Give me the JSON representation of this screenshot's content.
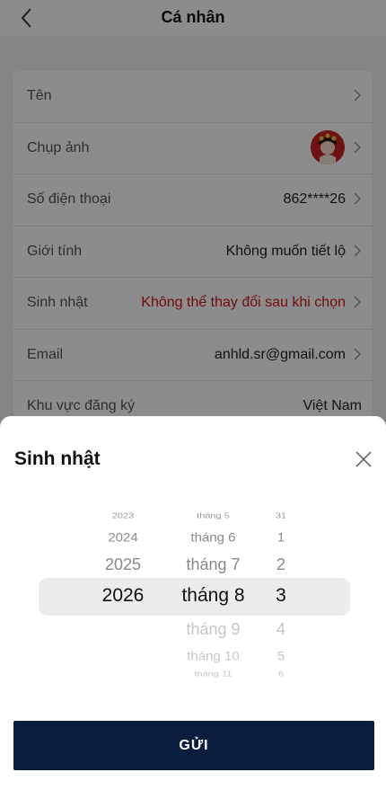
{
  "header": {
    "title": "Cá nhân"
  },
  "profile_rows": [
    {
      "label": "Tên",
      "value": ""
    },
    {
      "label": "Chụp ảnh",
      "value": ""
    },
    {
      "label": "Số điện thoại",
      "value": "862****26"
    },
    {
      "label": "Giới tính",
      "value": "Không muốn tiết lộ"
    },
    {
      "label": "Sinh nhật",
      "value": "Không thể thay đổi sau khi chọn"
    },
    {
      "label": "Email",
      "value": "anhld.sr@gmail.com"
    },
    {
      "label": "Khu vực đăng ký",
      "value": "Việt Nam"
    }
  ],
  "colors": {
    "warning": "#d4141c",
    "button": "#0b1d3f",
    "avatar": "#c82125"
  },
  "sheet": {
    "title": "Sinh nhật",
    "submit_label": "GỬI",
    "years": [
      "2023",
      "2024",
      "2025",
      "2026"
    ],
    "months": [
      "tháng 5",
      "tháng 6",
      "tháng 7",
      "tháng 8",
      "tháng 9",
      "tháng 10",
      "tháng 11"
    ],
    "days": [
      "31",
      "1",
      "2",
      "3",
      "4",
      "5",
      "6"
    ],
    "selected": {
      "year": "2026",
      "month": "tháng 8",
      "day": "3"
    }
  }
}
